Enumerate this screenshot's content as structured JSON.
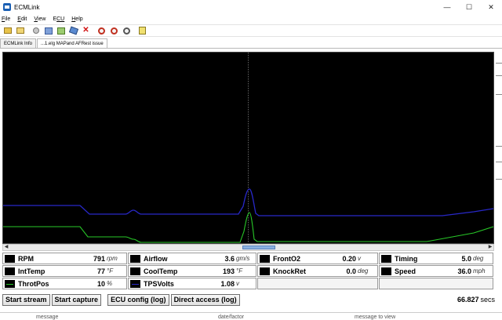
{
  "window": {
    "title": "ECMLink",
    "minimize": "—",
    "maximize": "☐",
    "close": "✕"
  },
  "menu": [
    {
      "label": "File",
      "accel": "F",
      "rest": "ile"
    },
    {
      "label": "Edit",
      "accel": "E",
      "rest": "dit"
    },
    {
      "label": "View",
      "accel": "V",
      "rest": "iew"
    },
    {
      "label": "ECU",
      "accel": "E",
      "rest": "CU"
    },
    {
      "label": "Help",
      "accel": "H",
      "rest": "elp"
    }
  ],
  "toolbar_icons": [
    "folder-icon",
    "open-folder-icon",
    "pin-icon",
    "window-icon",
    "chart-icon",
    "tool-icon",
    "delete-icon",
    "zoom-in-icon",
    "zoom-out-icon",
    "zoom-fit-icon",
    "document-icon"
  ],
  "tabs": [
    {
      "label": "ECMLink Info"
    },
    {
      "label": "...1.elg MAPand AFRest issue"
    }
  ],
  "chart_data": {
    "type": "line",
    "cursor_x": 0.5,
    "series": [
      {
        "name": "RPM",
        "color": "#2828c8"
      },
      {
        "name": "ThrotPos",
        "color": "#28c828"
      }
    ]
  },
  "gauges": [
    {
      "name": "RPM",
      "value": "791",
      "unit": "rpm",
      "swatch": "none"
    },
    {
      "name": "Airflow",
      "value": "3.6",
      "unit": "gm/s",
      "swatch": "none"
    },
    {
      "name": "FrontO2",
      "value": "0.20",
      "unit": "v",
      "swatch": "none"
    },
    {
      "name": "Timing",
      "value": "5.0",
      "unit": "deg",
      "swatch": "none"
    },
    {
      "name": "IntTemp",
      "value": "77",
      "unit": "°F",
      "swatch": "none"
    },
    {
      "name": "CoolTemp",
      "value": "193",
      "unit": "°F",
      "swatch": "none"
    },
    {
      "name": "KnockRet",
      "value": "0.0",
      "unit": "deg",
      "swatch": "none"
    },
    {
      "name": "Speed",
      "value": "36.0",
      "unit": "mph",
      "swatch": "none"
    },
    {
      "name": "ThrotPos",
      "value": "10",
      "unit": "%",
      "swatch": "#28c828"
    },
    {
      "name": "TPSVolts",
      "value": "1.08",
      "unit": "v",
      "swatch": "#2828c8"
    }
  ],
  "buttons": {
    "start_stream": "Start stream",
    "start_capture": "Start capture",
    "ecu_config": "ECU config (log)",
    "direct_access": "Direct access (log)"
  },
  "timer": {
    "value": "66.827",
    "unit": "secs"
  },
  "background_strip": [
    "message",
    "date/factor",
    "message to view"
  ]
}
